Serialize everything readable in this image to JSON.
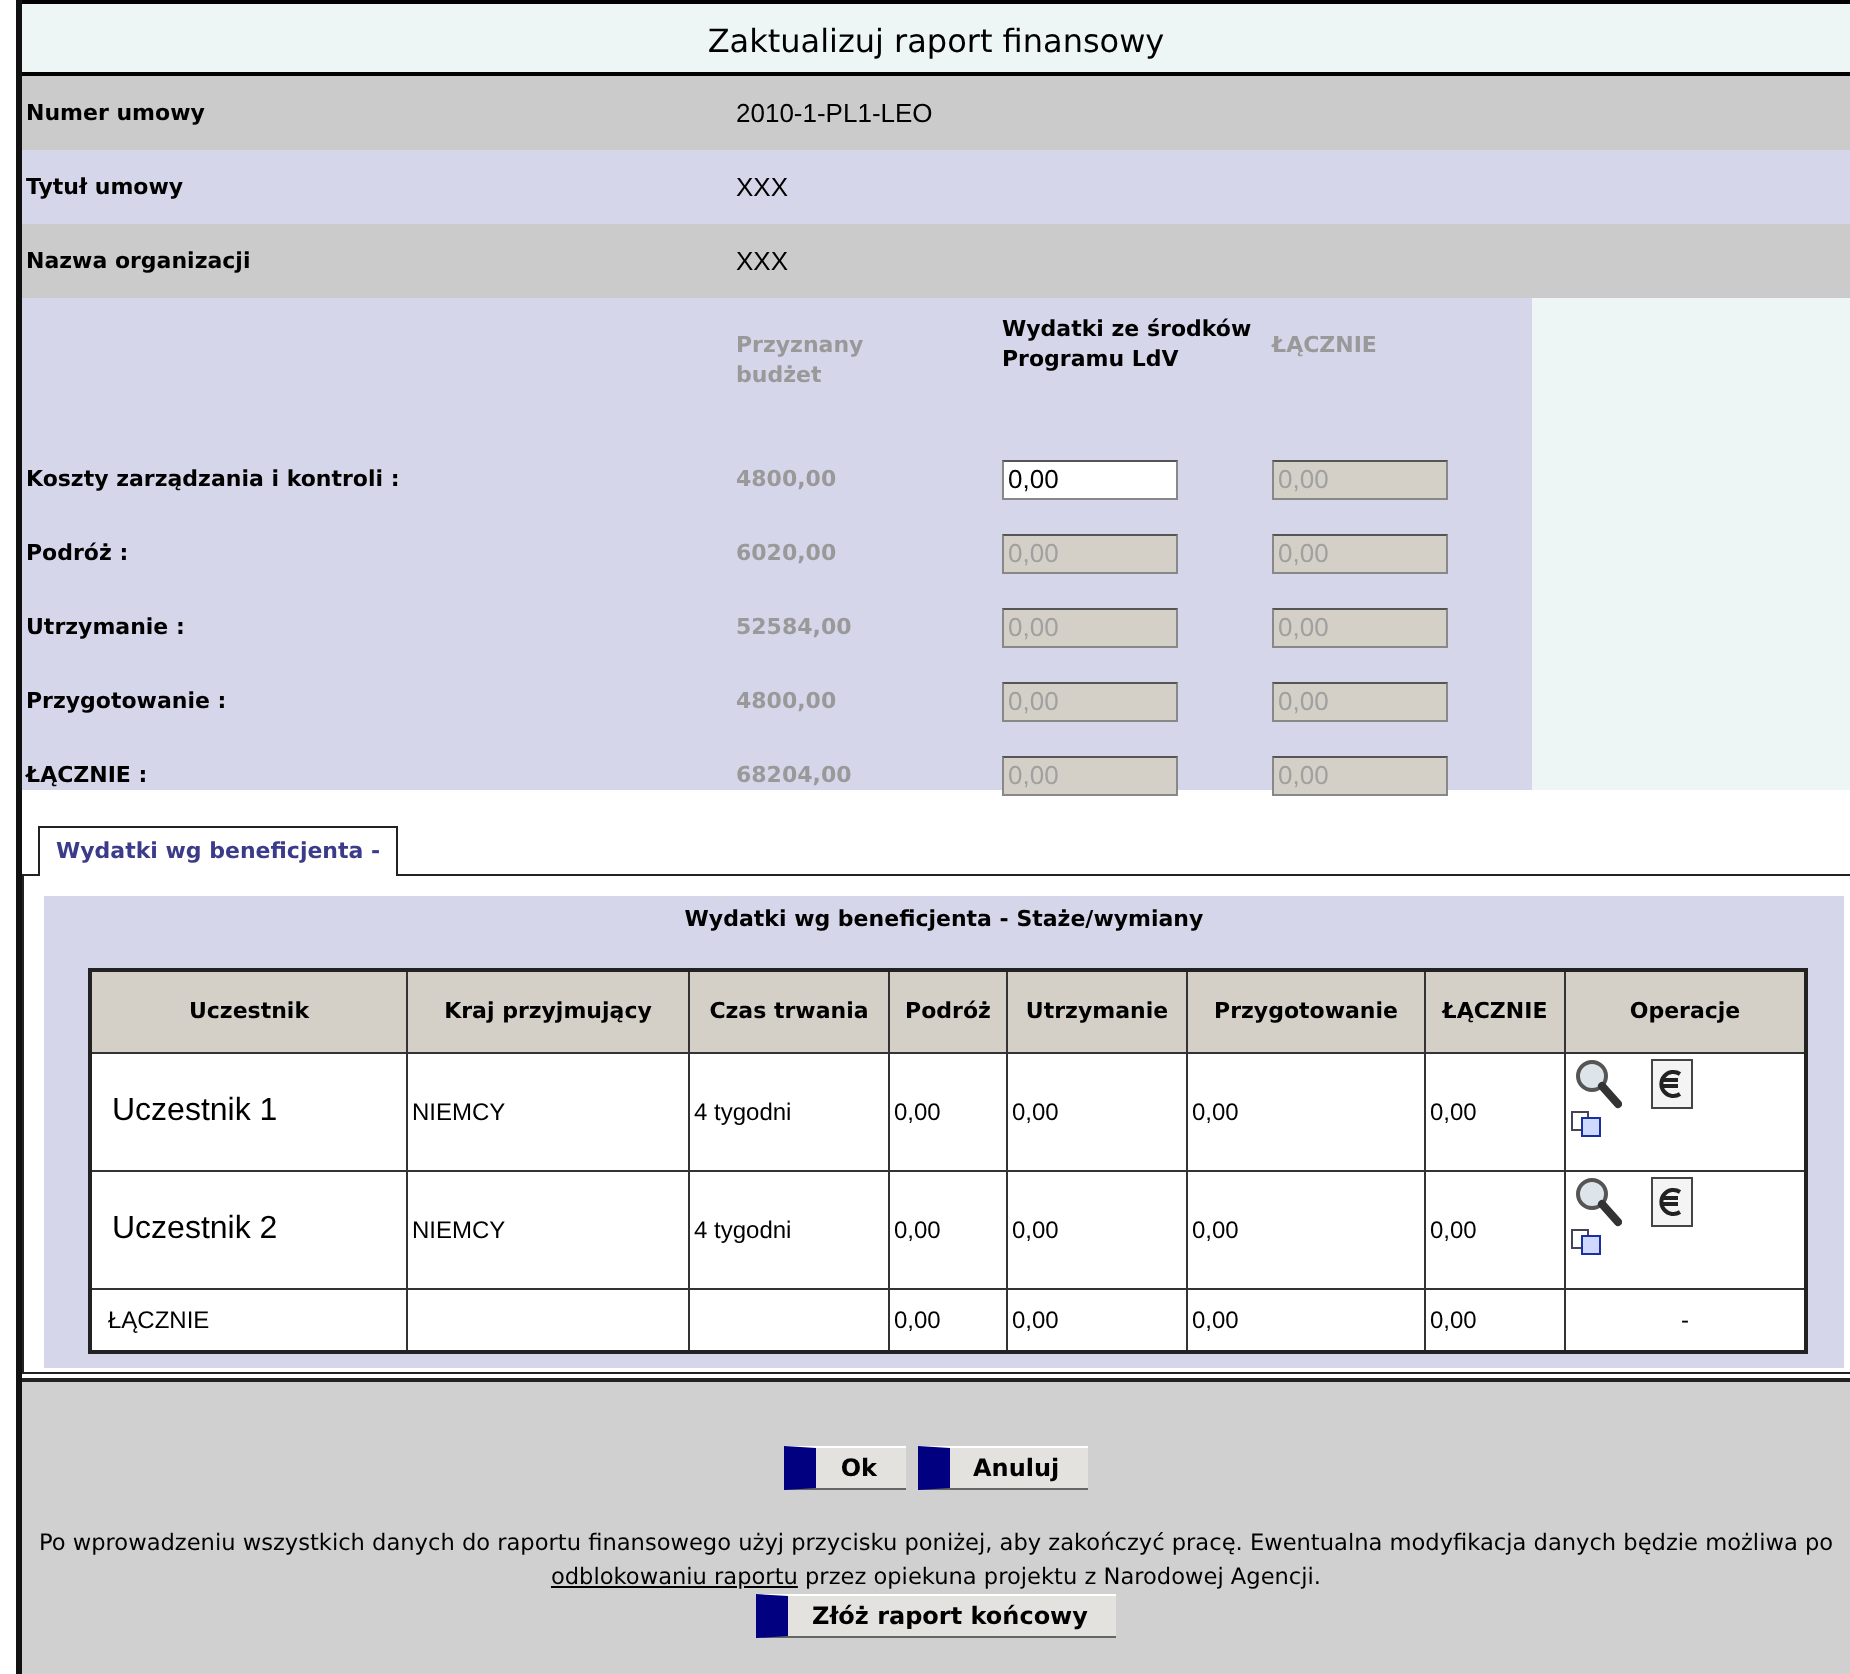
{
  "window": {
    "title": "Zaktualizuj raport finansowy"
  },
  "info_rows": [
    {
      "label": "Numer umowy",
      "value": "2010-1-PL1-LEO"
    },
    {
      "label": "Tytuł umowy",
      "value": "XXX"
    },
    {
      "label": "Nazwa organizacji",
      "value": "XXX"
    }
  ],
  "budget": {
    "columns": [
      {
        "label": "Przyznany budżet",
        "muted": true
      },
      {
        "label": "Wydatki ze środków Programu LdV",
        "muted": false
      },
      {
        "label": "ŁĄCZNIE",
        "muted": true
      }
    ],
    "rows": [
      {
        "label": "Koszty zarządzania i kontroli :",
        "granted": "4800,00",
        "spent": {
          "value": "0,00",
          "disabled": false
        },
        "total": {
          "value": "0,00",
          "disabled": true
        }
      },
      {
        "label": "Podróż :",
        "granted": "6020,00",
        "spent": {
          "value": "0,00",
          "disabled": true
        },
        "total": {
          "value": "0,00",
          "disabled": true
        }
      },
      {
        "label": "Utrzymanie :",
        "granted": "52584,00",
        "spent": {
          "value": "0,00",
          "disabled": true
        },
        "total": {
          "value": "0,00",
          "disabled": true
        }
      },
      {
        "label": "Przygotowanie :",
        "granted": "4800,00",
        "spent": {
          "value": "0,00",
          "disabled": true
        },
        "total": {
          "value": "0,00",
          "disabled": true
        }
      },
      {
        "label": "ŁĄCZNIE :",
        "granted": "68204,00",
        "spent": {
          "value": "0,00",
          "disabled": true
        },
        "total": {
          "value": "0,00",
          "disabled": true
        }
      }
    ]
  },
  "tabs": [
    {
      "label": "Wydatki wg beneficjenta -",
      "selected": true
    }
  ],
  "panel": {
    "title": "Wydatki wg beneficjenta - Staże/wymiany",
    "table": {
      "columns": [
        "Uczestnik",
        "Kraj przyjmujący",
        "Czas trwania",
        "Podróż",
        "Utrzymanie",
        "Przygotowanie",
        "ŁĄCZNIE",
        "Operacje"
      ],
      "rows": [
        {
          "kind": "participant",
          "cells": [
            "Uczestnik 1",
            "NIEMCY",
            "4 tygodni",
            "0,00",
            "0,00",
            "0,00",
            "0,00"
          ]
        },
        {
          "kind": "participant",
          "cells": [
            "Uczestnik 2",
            "NIEMCY",
            "4 tygodni",
            "0,00",
            "0,00",
            "0,00",
            "0,00"
          ]
        },
        {
          "kind": "total",
          "cells": [
            "ŁĄCZNIE",
            "",
            "",
            "0,00",
            "0,00",
            "0,00",
            "0,00"
          ],
          "operations": "-"
        }
      ]
    }
  },
  "buttons": [
    "Ok",
    "Anuluj"
  ],
  "note": {
    "before": "Po wprowadzeniu wszystkich danych do raportu finansowego użyj przycisku poniżej, aby zakończyć pracę. Ewentualna modyfikacja danych będzie możliwa po",
    "link": "odblokowaniu raportu",
    "after": "przez opiekuna projektu z Narodowej Agencji."
  },
  "final_button": "Złóż raport końcowy"
}
